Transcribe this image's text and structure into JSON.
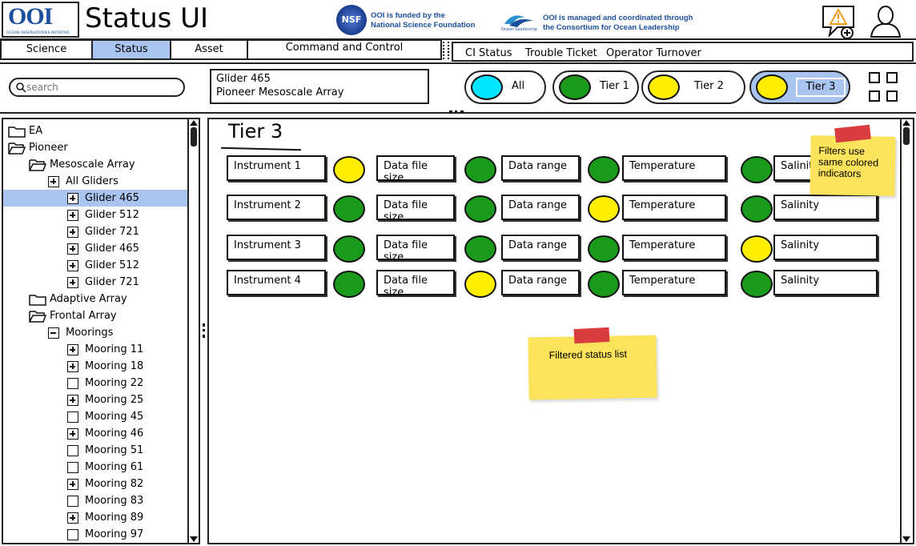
{
  "header": {
    "logo_text": "OOI",
    "logo_subtitle": "OCEAN OBSERVATORIES INITIATIVE",
    "title": "Status UI",
    "nsf_badge": "NSF",
    "nsf_line1": "OOI is funded by the",
    "nsf_line2": "National Science Foundation",
    "col_logo_text": "Ocean Leadership",
    "col_line1": "OOI is managed and coordinated through",
    "col_line2": "the Consortium for Ocean Leadership",
    "icons": [
      "alert-chat-icon",
      "user-icon"
    ]
  },
  "nav": {
    "tabs": [
      {
        "label": "Science"
      },
      {
        "label": "Status",
        "active": true
      },
      {
        "label": "Asset"
      },
      {
        "label": "Command and Control"
      }
    ],
    "links": [
      "CI Status",
      "Trouble Ticket",
      "Operator Turnover"
    ]
  },
  "filter_bar": {
    "search_placeholder": "search",
    "context_line1": "Glider 465",
    "context_line2": "Pioneer Mesoscale Array",
    "tiers": [
      {
        "label": "All",
        "color": "#00e5ff"
      },
      {
        "label": "Tier 1",
        "color": "#1a9a1a"
      },
      {
        "label": "Tier 2",
        "color": "#ffee00"
      },
      {
        "label": "Tier 3",
        "color": "#ffee00",
        "active": true
      }
    ],
    "grid_icon": "grid-view-icon"
  },
  "tree": {
    "items": [
      {
        "label": "EA",
        "kind": "folder",
        "indent": 0
      },
      {
        "label": "Pioneer",
        "kind": "folder-open",
        "indent": 0
      },
      {
        "label": "Mesoscale Array",
        "kind": "folder-open",
        "indent": 1
      },
      {
        "label": "All Gliders",
        "kind": "plus",
        "indent": 2
      },
      {
        "label": "Glider 465",
        "kind": "plus",
        "indent": 3,
        "selected": true
      },
      {
        "label": "Glider 512",
        "kind": "plus",
        "indent": 3
      },
      {
        "label": "Glider 721",
        "kind": "plus",
        "indent": 3
      },
      {
        "label": "Glider 465",
        "kind": "plus",
        "indent": 3
      },
      {
        "label": "Glider 512",
        "kind": "plus",
        "indent": 3
      },
      {
        "label": "Glider 721",
        "kind": "plus",
        "indent": 3
      },
      {
        "label": "Adaptive Array",
        "kind": "folder",
        "indent": 1
      },
      {
        "label": "Frontal Array",
        "kind": "folder-open",
        "indent": 1
      },
      {
        "label": "Moorings",
        "kind": "minus",
        "indent": 2
      },
      {
        "label": "Mooring 11",
        "kind": "plus",
        "indent": 3
      },
      {
        "label": "Mooring 18",
        "kind": "plus",
        "indent": 3
      },
      {
        "label": "Mooring 22",
        "kind": "empty",
        "indent": 3
      },
      {
        "label": "Mooring 25",
        "kind": "plus",
        "indent": 3
      },
      {
        "label": "Mooring 45",
        "kind": "empty",
        "indent": 3
      },
      {
        "label": "Mooring 46",
        "kind": "plus",
        "indent": 3
      },
      {
        "label": "Mooring 51",
        "kind": "empty",
        "indent": 3
      },
      {
        "label": "Mooring 61",
        "kind": "empty",
        "indent": 3
      },
      {
        "label": "Mooring 82",
        "kind": "plus",
        "indent": 3
      },
      {
        "label": "Mooring 83",
        "kind": "empty",
        "indent": 3
      },
      {
        "label": "Mooring 89",
        "kind": "plus",
        "indent": 3
      },
      {
        "label": "Mooring 97",
        "kind": "empty",
        "indent": 3
      }
    ]
  },
  "main": {
    "title": "Tier 3",
    "rows": [
      {
        "instrument": "Instrument 1",
        "status": [
          "yellow",
          "green",
          "green",
          "green"
        ],
        "metrics": [
          "Data file size",
          "Data range",
          "Temperature",
          "Salinity"
        ]
      },
      {
        "instrument": "Instrument 2",
        "status": [
          "green",
          "green",
          "yellow",
          "green"
        ],
        "metrics": [
          "Data file size",
          "Data range",
          "Temperature",
          "Salinity"
        ]
      },
      {
        "instrument": "Instrument 3",
        "status": [
          "green",
          "green",
          "green",
          "yellow"
        ],
        "metrics": [
          "Data file size",
          "Data range",
          "Temperature",
          "Salinity"
        ]
      },
      {
        "instrument": "Instrument 4",
        "status": [
          "green",
          "yellow",
          "green",
          "green"
        ],
        "metrics": [
          "Data file size",
          "Data range",
          "Temperature",
          "Salinity"
        ]
      }
    ],
    "colors": {
      "green": "#1a9a1a",
      "yellow": "#ffee00"
    }
  },
  "notes": {
    "filters": "Filters use same colored indicators",
    "list": "Filtered status list"
  }
}
